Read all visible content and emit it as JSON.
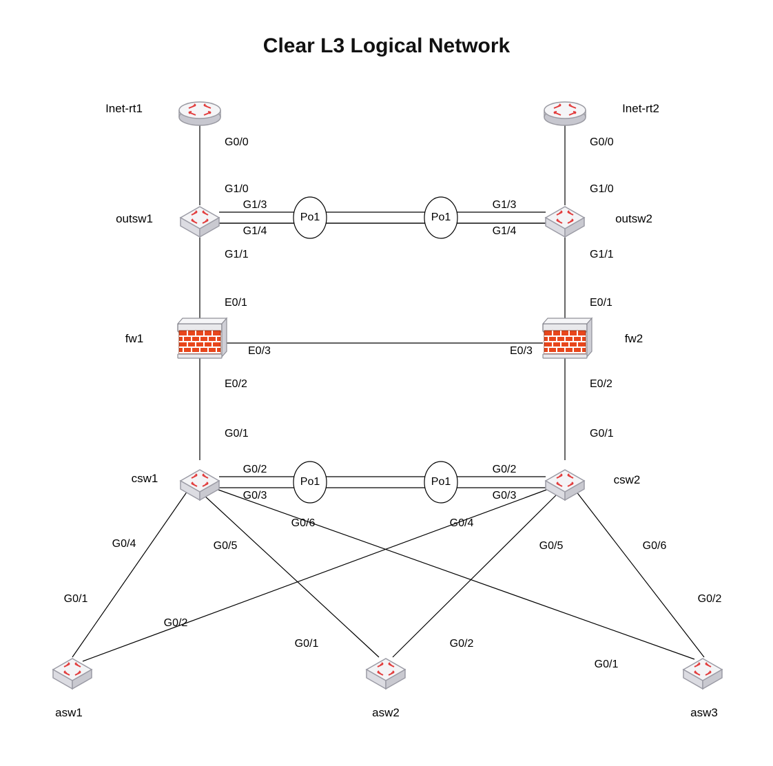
{
  "title": "Clear L3 Logical Network",
  "devices": {
    "inet_rt1": "Inet-rt1",
    "inet_rt2": "Inet-rt2",
    "outsw1": "outsw1",
    "outsw2": "outsw2",
    "fw1": "fw1",
    "fw2": "fw2",
    "csw1": "csw1",
    "csw2": "csw2",
    "asw1": "asw1",
    "asw2": "asw2",
    "asw3": "asw3"
  },
  "po_labels": {
    "po_top_left": "Po1",
    "po_top_right": "Po1",
    "po_bottom_left": "Po1",
    "po_bottom_right": "Po1"
  },
  "interface_labels": {
    "rt1_g00": "G0/0",
    "rt2_g00": "G0/0",
    "outsw1_g10": "G1/0",
    "outsw2_g10": "G1/0",
    "outsw1_g13": "G1/3",
    "outsw1_g14": "G1/4",
    "outsw2_g13": "G1/3",
    "outsw2_g14": "G1/4",
    "outsw1_g11": "G1/1",
    "outsw2_g11": "G1/1",
    "fw1_e01": "E0/1",
    "fw2_e01": "E0/1",
    "fw1_e03": "E0/3",
    "fw2_e03": "E0/3",
    "fw1_e02": "E0/2",
    "fw2_e02": "E0/2",
    "csw1_g01": "G0/1",
    "csw2_g01": "G0/1",
    "csw1_g02": "G0/2",
    "csw1_g03": "G0/3",
    "csw2_g02": "G0/2",
    "csw2_g03": "G0/3",
    "csw1_g04": "G0/4",
    "csw1_g05": "G0/5",
    "csw1_g06": "G0/6",
    "csw2_g04": "G0/4",
    "csw2_g05": "G0/5",
    "csw2_g06": "G0/6",
    "asw1_g01": "G0/1",
    "asw1_g02": "G0/2",
    "asw2_g01": "G0/1",
    "asw2_g02": "G0/2",
    "asw3_g01": "G0/1",
    "asw3_g02": "G0/2"
  }
}
